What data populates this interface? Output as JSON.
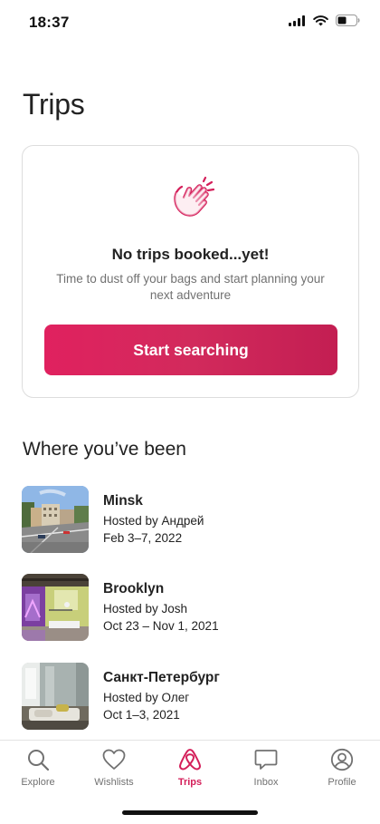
{
  "status_bar": {
    "time": "18:37"
  },
  "page": {
    "title": "Trips"
  },
  "empty_state": {
    "icon": "clapping-hands-icon",
    "heading": "No trips booked...yet!",
    "text": "Time to dust off your bags and start planning your next adventure",
    "button_label": "Start searching"
  },
  "history": {
    "title": "Where you’ve been",
    "trips": [
      {
        "city": "Minsk",
        "host": "Hosted by Андрей",
        "dates": "Feb 3–7, 2022"
      },
      {
        "city": "Brooklyn",
        "host": "Hosted by Josh",
        "dates": "Oct 23 – Nov 1, 2021"
      },
      {
        "city": "Санкт-Петербург",
        "host": "Hosted by Олег",
        "dates": "Oct 1–3, 2021"
      }
    ]
  },
  "nav": {
    "items": [
      {
        "label": "Explore",
        "icon": "search-icon"
      },
      {
        "label": "Wishlists",
        "icon": "heart-icon"
      },
      {
        "label": "Trips",
        "icon": "airbnb-logo-icon",
        "active": true
      },
      {
        "label": "Inbox",
        "icon": "chat-bubble-icon"
      },
      {
        "label": "Profile",
        "icon": "profile-icon"
      }
    ]
  },
  "colors": {
    "accent": "#d41f5a",
    "button_start": "#e0215f",
    "button_end": "#c31e52",
    "muted_text": "#717171"
  }
}
